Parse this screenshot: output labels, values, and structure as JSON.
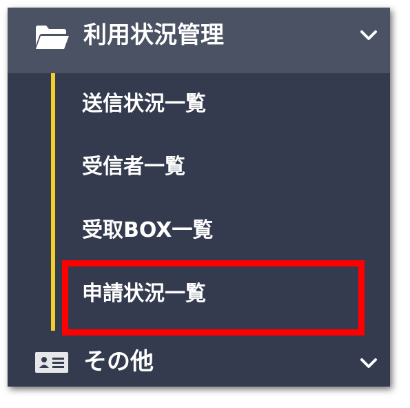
{
  "menu": {
    "usage_section": {
      "label": "利用状況管理",
      "icon": "folder-open-icon",
      "expanded": true,
      "items": [
        {
          "label": "送信状況一覧"
        },
        {
          "label": "受信者一覧"
        },
        {
          "label": "受取BOX一覧"
        },
        {
          "label": "申請状況一覧"
        }
      ]
    },
    "other_section": {
      "label": "その他",
      "icon": "id-card-icon",
      "expanded": false
    }
  },
  "colors": {
    "menu_background": "#343b4e",
    "header_background": "#4b5263",
    "accent": "#f1cf2b",
    "highlight": "#ff0000",
    "text": "#ffffff"
  }
}
